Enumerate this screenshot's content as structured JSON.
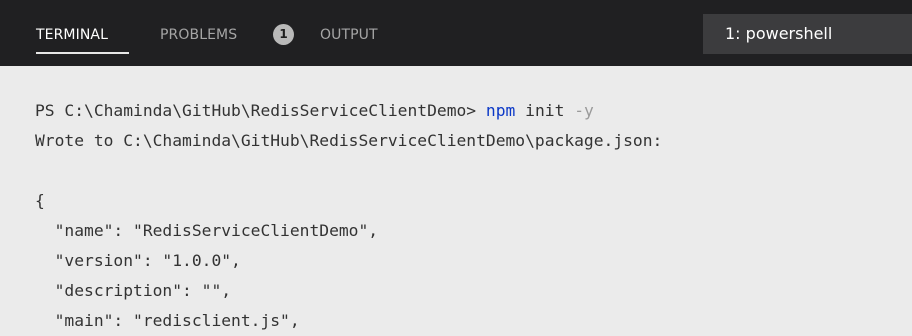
{
  "panel": {
    "tabs": [
      {
        "label": "TERMINAL",
        "active": true
      },
      {
        "label": "PROBLEMS",
        "active": false,
        "badge": "1"
      },
      {
        "label": "OUTPUT",
        "active": false
      }
    ],
    "shell_selector": "1: powershell"
  },
  "terminal": {
    "prompt": "PS C:\\Chaminda\\GitHub\\RedisServiceClientDemo>",
    "command": "npm",
    "command_args": "init",
    "command_flag": "-y",
    "wrote_line": "Wrote to C:\\Chaminda\\GitHub\\RedisServiceClientDemo\\package.json:",
    "json_lines": [
      "{",
      "  \"name\": \"RedisServiceClientDemo\",",
      "  \"version\": \"1.0.0\",",
      "  \"description\": \"\",",
      "  \"main\": \"redisclient.js\","
    ]
  },
  "colors": {
    "tabbar_bg": "#202022",
    "terminal_bg": "#ebebeb",
    "command_color": "#0b38c7",
    "flag_color": "#9a9a9a",
    "text_color": "#333333"
  }
}
